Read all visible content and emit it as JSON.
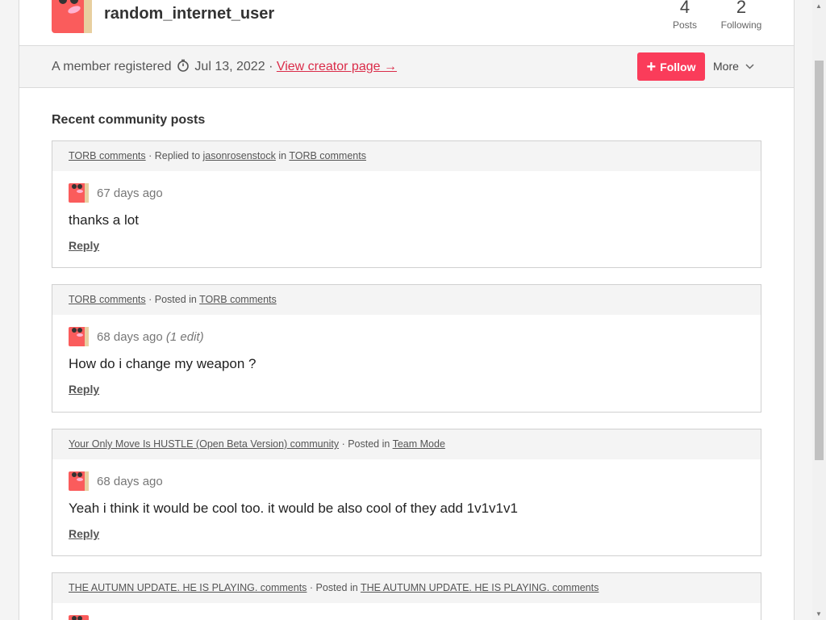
{
  "user": {
    "username": "random_internet_user",
    "posts_count": "4",
    "posts_label": "Posts",
    "following_count": "2",
    "following_label": "Following"
  },
  "member_bar": {
    "registered_prefix": "A member registered",
    "registered_date": "Jul 13, 2022",
    "separator": "·",
    "creator_link": "View creator page →",
    "follow_label": "Follow",
    "more_label": "More"
  },
  "section_title": "Recent community posts",
  "colors": {
    "accent": "#fa3c5a",
    "link": "#da2c49",
    "avatar": "#fa5c5c"
  },
  "posts": [
    {
      "source": "TORB comments",
      "action": "· Replied to",
      "target_user": "jasonrosenstock",
      "in_word": "in",
      "location": "TORB comments",
      "time": "67 days ago",
      "edit": "",
      "text": "thanks a lot",
      "reply": "Reply"
    },
    {
      "source": "TORB comments",
      "action": "· Posted in",
      "location": "TORB comments",
      "time": "68 days ago",
      "edit": "(1 edit)",
      "text": "How do i change my weapon ?",
      "reply": "Reply"
    },
    {
      "source": "Your Only Move Is HUSTLE (Open Beta Version) community",
      "action": "· Posted in",
      "location": "Team Mode",
      "time": "68 days ago",
      "edit": "",
      "text": "Yeah i think it would be cool too. it would be also cool of they add 1v1v1v1",
      "reply": "Reply"
    },
    {
      "source": "THE AUTUMN UPDATE. HE IS PLAYING. comments",
      "action": "· Posted in",
      "location": "THE AUTUMN UPDATE. HE IS PLAYING. comments"
    }
  ]
}
